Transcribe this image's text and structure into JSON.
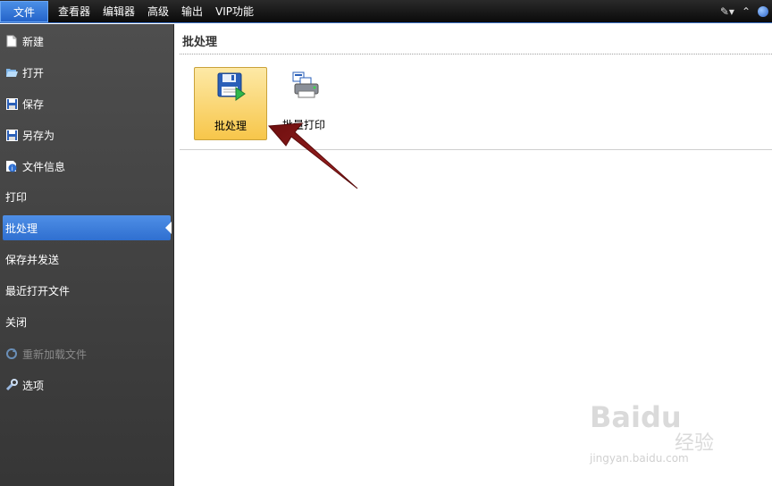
{
  "menubar": {
    "file": "文件",
    "items": [
      "查看器",
      "编辑器",
      "高级",
      "输出",
      "VIP功能"
    ],
    "right_icons": [
      "note-icon",
      "caret-up-icon",
      "help-globe-icon"
    ]
  },
  "sidebar": {
    "items": [
      {
        "label": "新建",
        "icon": "new-doc-icon"
      },
      {
        "label": "打开",
        "icon": "folder-open-icon"
      },
      {
        "label": "保存",
        "icon": "save-icon"
      },
      {
        "label": "另存为",
        "icon": "save-as-icon"
      },
      {
        "label": "文件信息",
        "icon": "info-icon"
      },
      {
        "label": "打印",
        "icon": ""
      },
      {
        "label": "批处理",
        "icon": "",
        "active": true
      },
      {
        "label": "保存并发送",
        "icon": ""
      },
      {
        "label": "最近打开文件",
        "icon": ""
      },
      {
        "label": "关闭",
        "icon": ""
      },
      {
        "label": "重新加载文件",
        "icon": "reload-icon",
        "disabled": true
      },
      {
        "label": "选项",
        "icon": "wrench-icon"
      }
    ]
  },
  "main": {
    "title": "批处理",
    "tiles": [
      {
        "label": "批处理",
        "icon": "batch-save-icon",
        "selected": true
      },
      {
        "label": "批量打印",
        "icon": "batch-print-icon",
        "selected": false
      }
    ]
  },
  "annotation": {
    "arrow_color": "#8b1a1a"
  },
  "watermark": {
    "brand": "Baidu",
    "cn": "经验",
    "url": "jingyan.baidu.com"
  }
}
